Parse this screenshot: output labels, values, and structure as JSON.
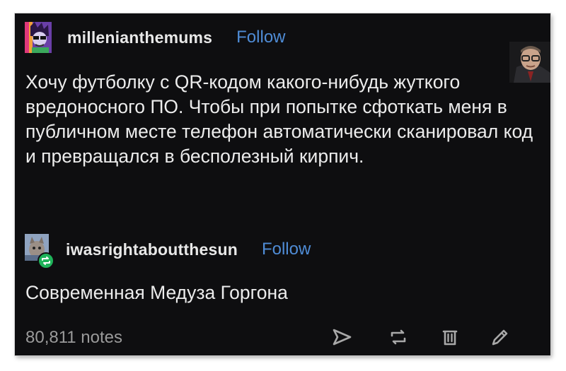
{
  "post": {
    "author": "millenianthemums",
    "follow_label": "Follow",
    "text": "Хочу футболку с QR-кодом какого-нибудь жуткого вредоносного ПО. Чтобы при попытке сфоткать меня в публичном месте телефон автоматически сканировал код и превращался в бесполезный кирпич."
  },
  "reblog": {
    "author": "iwasrightaboutthesun",
    "follow_label": "Follow",
    "text": "Современная Медуза Горгона"
  },
  "footer": {
    "notes": "80,811 notes",
    "actions": [
      "share-icon",
      "reblog-icon",
      "delete-icon",
      "edit-icon"
    ]
  },
  "colors": {
    "background": "#0e0e10",
    "text": "#ececec",
    "link": "#4f8cd6",
    "muted": "#9a9a9a",
    "reblog_green": "#1fb35a"
  }
}
